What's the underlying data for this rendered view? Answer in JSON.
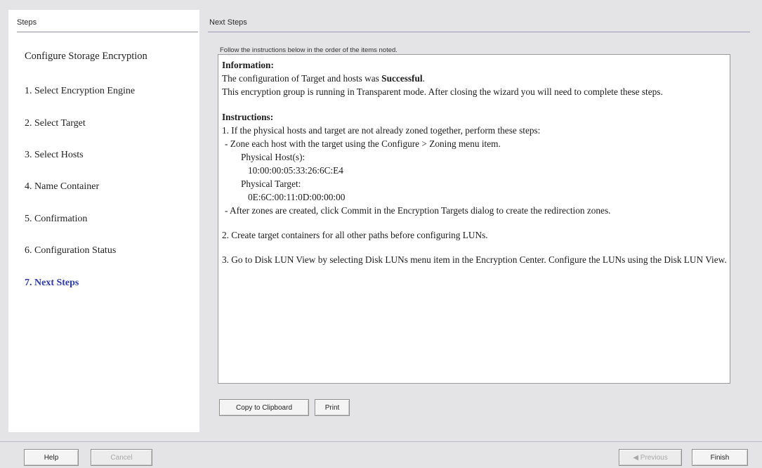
{
  "steps_panel": {
    "header": "Steps",
    "title": "Configure Storage Encryption",
    "items": [
      {
        "label": "1. Select Encryption Engine"
      },
      {
        "label": "2. Select Target"
      },
      {
        "label": "3. Select Hosts"
      },
      {
        "label": "4. Name Container"
      },
      {
        "label": "5. Confirmation"
      },
      {
        "label": "6. Configuration Status"
      },
      {
        "label": "7. Next Steps"
      }
    ]
  },
  "main": {
    "header": "Next Steps",
    "instruction": "Follow the instructions below in the order of the items noted.",
    "info": {
      "info_heading": "Information:",
      "success_prefix": "The configuration of Target and hosts was ",
      "success_word": "Successful",
      "success_suffix": ".",
      "mode_text": "This encryption group is running in Transparent mode. After closing the wizard you will need to complete these steps.",
      "instructions_heading": "Instructions:",
      "step1": "1. If the physical hosts and target are not already zoned together, perform these steps:",
      "step1a": "- Zone each host with the target using the Configure > Zoning menu item.",
      "physical_hosts_label": "Physical Host(s):",
      "physical_hosts_value": "10:00:00:05:33:26:6C:E4",
      "physical_target_label": "Physical Target:",
      "physical_target_value": "0E:6C:00:11:0D:00:00:00",
      "step1b": "- After zones are created, click Commit in the Encryption Targets dialog to create the redirection zones.",
      "step2": "2. Create target containers for all other paths before configuring LUNs.",
      "step3": "3. Go to Disk LUN View by selecting Disk LUNs menu item in the Encryption Center. Configure the LUNs using the Disk LUN View."
    },
    "copy_button": "Copy to Clipboard",
    "print_button": "Print"
  },
  "footer": {
    "help_button": "Help",
    "cancel_button": "Cancel",
    "previous_button": "◀ Previous",
    "finish_button": "Finish"
  }
}
